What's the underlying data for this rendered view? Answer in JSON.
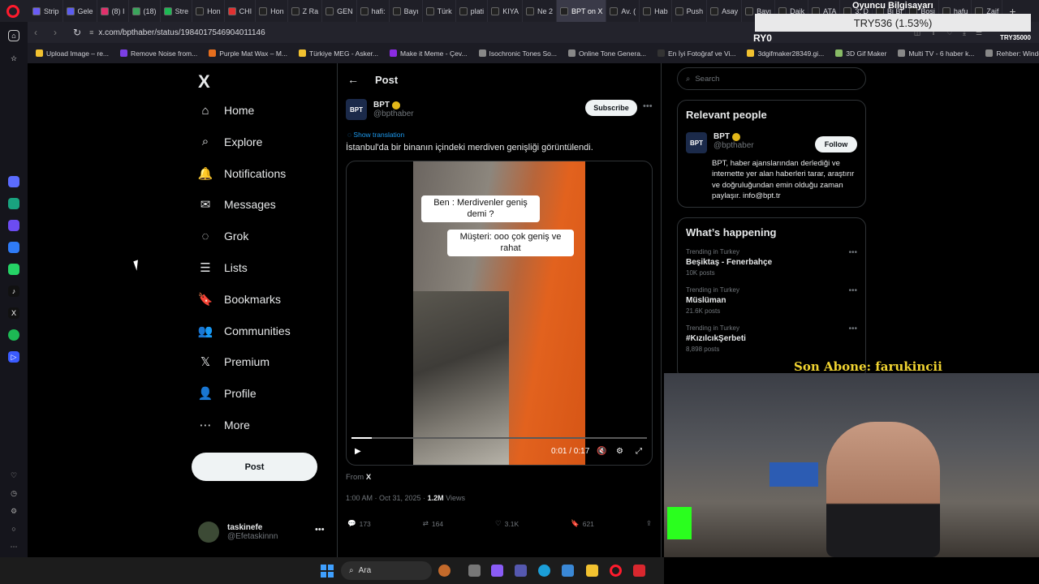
{
  "browser": {
    "tabs": [
      "Strip",
      "Gele",
      "(8) I",
      "(18)",
      "Stre",
      "Hon",
      "CHI",
      "Hon",
      "Z Ra",
      "GEN",
      "hafi:",
      "Bayı",
      "Türk",
      "plati",
      "KIYA",
      "Ne 2",
      "BPT on X",
      "Av. (",
      "Hab",
      "Push",
      "Asay",
      "Bayı",
      "Daik",
      "ATA",
      "3. D",
      "Bi Bi",
      "Bosi",
      "hafu",
      "Zaif"
    ],
    "url": "x.com/bpthaber/status/1984017546904011146",
    "bookmarks": [
      "Upload Image – re...",
      "Remove Noise from...",
      "Purple Mat Wax – M...",
      "Türkiye MEG - Asker...",
      "Make it Meme - Çev...",
      "Isochronic Tones So...",
      "Online Tone Genera...",
      "En İyi Fotoğraf ve Vi...",
      "3dgifmaker28349.gi...",
      "3D Gif Maker",
      "Multi TV - 6 haber k...",
      "Rehber: Windows 1..."
    ]
  },
  "nav": {
    "logo": "X",
    "items": [
      {
        "label": "Home",
        "icon": "⌂"
      },
      {
        "label": "Explore",
        "icon": "⌕"
      },
      {
        "label": "Notifications",
        "icon": "🔔"
      },
      {
        "label": "Messages",
        "icon": "✉"
      },
      {
        "label": "Grok",
        "icon": "◌"
      },
      {
        "label": "Lists",
        "icon": "☰"
      },
      {
        "label": "Bookmarks",
        "icon": "🔖"
      },
      {
        "label": "Communities",
        "icon": "👥"
      },
      {
        "label": "Premium",
        "icon": "𝕏"
      },
      {
        "label": "Profile",
        "icon": "👤"
      },
      {
        "label": "More",
        "icon": "⋯"
      }
    ],
    "post_button": "Post",
    "account": {
      "name": "taskinefe",
      "handle": "@Efetaskinnn"
    }
  },
  "post": {
    "header_title": "Post",
    "author_name": "BPT",
    "author_handle": "@bpthaber",
    "avatar_text": "BPT",
    "subscribe_label": "Subscribe",
    "show_translation": "Show translation",
    "text": "İstanbul'da bir binanın içindeki merdiven genişliği görüntülendi.",
    "video": {
      "caption_1": "Ben : Merdivenler geniş demi ?",
      "caption_2": "Müşteri: ooo çok geniş ve rahat",
      "time": "0:01 / 0:17",
      "progress": 0.07
    },
    "from_label": "From",
    "from_source": "X",
    "timestamp": "1:00 AM · Oct 31, 2025 ·",
    "views_count": "1.2M",
    "views_label": "Views",
    "stats": {
      "replies": "173",
      "reposts": "164",
      "likes": "3.1K",
      "bookmarks": "621"
    }
  },
  "sidebar": {
    "search_placeholder": "Search",
    "relevant_title": "Relevant people",
    "person": {
      "name": "BPT",
      "handle": "@bpthaber",
      "follow_label": "Follow",
      "bio": "BPT, haber ajanslarından derlediği ve internette yer alan haberleri tarar, araştırır ve doğruluğundan emin olduğu zaman paylaşır. info@bpt.tr"
    },
    "happening_title": "What’s happening",
    "trends": [
      {
        "context": "Trending in Turkey",
        "name": "Beşiktaş - Fenerbahçe",
        "count": "10K posts"
      },
      {
        "context": "Trending in Turkey",
        "name": "Müslüman",
        "count": "21.6K posts"
      },
      {
        "context": "Trending in Turkey",
        "name": "#KızılcıkŞerbeti",
        "count": "8,898 posts"
      }
    ]
  },
  "overlay": {
    "ticker_title": "Oyuncu Bilgisayarı",
    "ticker": "TRY536 (1.53%)",
    "ticker_left": "RY0",
    "ticker_right": "TRY35000",
    "sub_label": "Son Abone: farukincii"
  },
  "taskbar": {
    "search": "Ara"
  },
  "colors": {
    "accent": "#1d9bf0",
    "background": "#000000",
    "verified": "#e2b719"
  }
}
